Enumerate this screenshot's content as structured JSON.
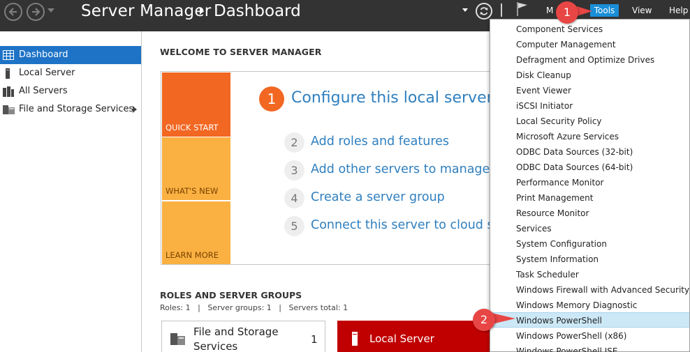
{
  "titlebar": {
    "app_name": "Server Manager",
    "page": "Dashboard",
    "menus": {
      "manage": "M",
      "tools": "Tools",
      "view": "View",
      "help": "Help"
    }
  },
  "sidebar": {
    "items": [
      {
        "label": "Dashboard",
        "icon": "dashboard-icon",
        "selected": true
      },
      {
        "label": "Local Server",
        "icon": "server-icon"
      },
      {
        "label": "All Servers",
        "icon": "servers-icon"
      },
      {
        "label": "File and Storage Services",
        "icon": "storage-icon"
      }
    ]
  },
  "welcome": {
    "heading": "WELCOME TO SERVER MANAGER",
    "tiles": [
      "QUICK START",
      "WHAT'S NEW",
      "LEARN MORE"
    ],
    "steps": [
      {
        "num": "1",
        "label": "Configure this local server"
      },
      {
        "num": "2",
        "label": "Add roles and features"
      },
      {
        "num": "3",
        "label": "Add other servers to manage"
      },
      {
        "num": "4",
        "label": "Create a server group"
      },
      {
        "num": "5",
        "label": "Connect this server to cloud serv"
      }
    ]
  },
  "roles": {
    "heading": "ROLES AND SERVER GROUPS",
    "summary": "Roles: 1   |   Server groups: 1   |   Servers total: 1",
    "cards": [
      {
        "name": "File and Storage Services",
        "count": "1"
      },
      {
        "name": "Local Server",
        "count": ""
      }
    ]
  },
  "tools_menu": {
    "items": [
      "Component Services",
      "Computer Management",
      "Defragment and Optimize Drives",
      "Disk Cleanup",
      "Event Viewer",
      "iSCSI Initiator",
      "Local Security Policy",
      "Microsoft Azure Services",
      "ODBC Data Sources (32-bit)",
      "ODBC Data Sources (64-bit)",
      "Performance Monitor",
      "Print Management",
      "Resource Monitor",
      "Services",
      "System Configuration",
      "System Information",
      "Task Scheduler",
      "Windows Firewall with Advanced Security",
      "Windows Memory Diagnostic",
      "Windows PowerShell",
      "Windows PowerShell (x86)",
      "Windows PowerShell ISE"
    ],
    "highlighted": "Windows PowerShell"
  },
  "callouts": [
    "1",
    "2"
  ],
  "colors": {
    "titlebar": "#333333",
    "accent": "#1e73c6",
    "quick_start": "#f26822",
    "whats_new": "#fbb042",
    "local_server_card": "#c00000",
    "callout": "#e84545"
  }
}
